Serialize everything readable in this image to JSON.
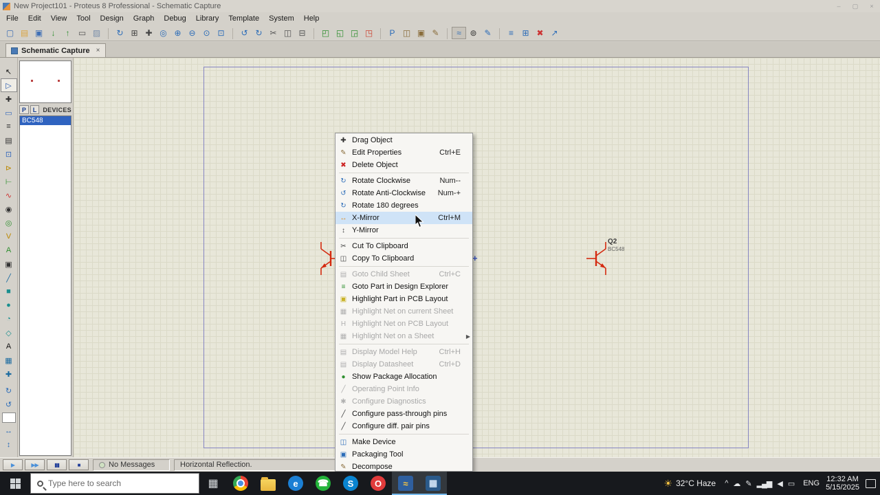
{
  "window": {
    "title": "New Project101 - Proteus 8 Professional - Schematic Capture",
    "minimize": "–",
    "maximize": "▢",
    "close": "×"
  },
  "menubar": {
    "items": [
      {
        "name": "menu-file",
        "label": "File"
      },
      {
        "name": "menu-edit",
        "label": "Edit"
      },
      {
        "name": "menu-view",
        "label": "View"
      },
      {
        "name": "menu-tool",
        "label": "Tool"
      },
      {
        "name": "menu-design",
        "label": "Design"
      },
      {
        "name": "menu-graph",
        "label": "Graph"
      },
      {
        "name": "menu-debug",
        "label": "Debug"
      },
      {
        "name": "menu-library",
        "label": "Library"
      },
      {
        "name": "menu-template",
        "label": "Template"
      },
      {
        "name": "menu-system",
        "label": "System"
      },
      {
        "name": "menu-help",
        "label": "Help"
      }
    ]
  },
  "toolbar": {
    "icons": [
      {
        "name": "new-project-icon",
        "glyph": "▢",
        "color": "#3f6fb5",
        "cls": ""
      },
      {
        "name": "open-project-icon",
        "glyph": "▤",
        "color": "#d9a441",
        "cls": ""
      },
      {
        "name": "save-project-icon",
        "glyph": "▣",
        "color": "#3f6fb5",
        "cls": ""
      },
      {
        "name": "import-section-icon",
        "glyph": "↓",
        "color": "#2f8f2f",
        "cls": ""
      },
      {
        "name": "export-section-icon",
        "glyph": "↑",
        "color": "#2f8f2f",
        "cls": ""
      },
      {
        "name": "print-icon",
        "glyph": "▭",
        "color": "#555555",
        "cls": ""
      },
      {
        "name": "mark-output-area-icon",
        "glyph": "▨",
        "color": "#7a8faa",
        "cls": ""
      },
      {
        "name": "redraw-icon",
        "glyph": "↻",
        "color": "#2b6cb8",
        "cls": "grp"
      },
      {
        "name": "toggle-grid-icon",
        "glyph": "⊞",
        "color": "#444444",
        "cls": ""
      },
      {
        "name": "false-origin-icon",
        "glyph": "✚",
        "color": "#444444",
        "cls": ""
      },
      {
        "name": "centre-at-cursor-icon",
        "glyph": "◎",
        "color": "#2b6cb8",
        "cls": ""
      },
      {
        "name": "zoom-in-icon",
        "glyph": "⊕",
        "color": "#2b6cb8",
        "cls": ""
      },
      {
        "name": "zoom-out-icon",
        "glyph": "⊖",
        "color": "#2b6cb8",
        "cls": ""
      },
      {
        "name": "zoom-all-icon",
        "glyph": "⊙",
        "color": "#2b6cb8",
        "cls": ""
      },
      {
        "name": "zoom-area-icon",
        "glyph": "⊡",
        "color": "#2b6cb8",
        "cls": ""
      },
      {
        "name": "undo-icon",
        "glyph": "↺",
        "color": "#2b6cb8",
        "cls": "grp"
      },
      {
        "name": "redo-icon",
        "glyph": "↻",
        "color": "#2b6cb8",
        "cls": ""
      },
      {
        "name": "cut-icon",
        "glyph": "✂",
        "color": "#555555",
        "cls": ""
      },
      {
        "name": "copy-icon",
        "glyph": "◫",
        "color": "#555555",
        "cls": ""
      },
      {
        "name": "paste-icon",
        "glyph": "⊟",
        "color": "#555555",
        "cls": ""
      },
      {
        "name": "copy-block-icon",
        "glyph": "◰",
        "color": "#2f8f2f",
        "cls": "grp"
      },
      {
        "name": "move-block-icon",
        "glyph": "◱",
        "color": "#2f8f2f",
        "cls": ""
      },
      {
        "name": "rotate-block-icon",
        "glyph": "◲",
        "color": "#2f8f2f",
        "cls": ""
      },
      {
        "name": "delete-block-icon",
        "glyph": "◳",
        "color": "#cc4433",
        "cls": ""
      },
      {
        "name": "pick-parts-icon",
        "glyph": "P",
        "color": "#2b6cb8",
        "cls": "grp"
      },
      {
        "name": "make-device-icon",
        "glyph": "◫",
        "color": "#8a6d3b",
        "cls": ""
      },
      {
        "name": "packaging-tool-icon",
        "glyph": "▣",
        "color": "#8a6d3b",
        "cls": ""
      },
      {
        "name": "decompose-icon",
        "glyph": "✎",
        "color": "#8a6d3b",
        "cls": ""
      },
      {
        "name": "wire-autorouter-icon",
        "glyph": "≈",
        "color": "#2b6cb8",
        "cls": "grp pressed"
      },
      {
        "name": "search-tag-icon",
        "glyph": "⊚",
        "color": "#333333",
        "cls": ""
      },
      {
        "name": "property-assignment-icon",
        "glyph": "✎",
        "color": "#2b6cb8",
        "cls": ""
      },
      {
        "name": "design-explorer-icon",
        "glyph": "≡",
        "color": "#2b6cb8",
        "cls": "grp"
      },
      {
        "name": "new-sheet-icon",
        "glyph": "⊞",
        "color": "#2b6cb8",
        "cls": ""
      },
      {
        "name": "remove-sheet-icon",
        "glyph": "✖",
        "color": "#cc3333",
        "cls": ""
      },
      {
        "name": "goto-sheet-icon",
        "glyph": "↗",
        "color": "#2b6cb8",
        "cls": ""
      }
    ]
  },
  "tabbar": {
    "active_tab": "Schematic Capture",
    "close_glyph": "×"
  },
  "sidebar": {
    "tools": [
      {
        "name": "selection-mode-icon",
        "glyph": "↖",
        "color": "#111111",
        "cls": ""
      },
      {
        "name": "component-mode-icon",
        "glyph": "▷",
        "color": "#2255aa",
        "cls": "active"
      },
      {
        "name": "junction-dot-mode-icon",
        "glyph": "✚",
        "color": "#333333",
        "cls": ""
      },
      {
        "name": "wire-label-mode-icon",
        "glyph": "▭",
        "color": "#3366bb",
        "cls": ""
      },
      {
        "name": "text-script-mode-icon",
        "glyph": "≡",
        "color": "#333333",
        "cls": ""
      },
      {
        "name": "buses-mode-icon",
        "glyph": "▤",
        "color": "#333333",
        "cls": ""
      },
      {
        "name": "subcircuit-mode-icon",
        "glyph": "⊡",
        "color": "#3366bb",
        "cls": ""
      },
      {
        "name": "terminal-mode-icon",
        "glyph": "⊳",
        "color": "#bb8800",
        "cls": ""
      },
      {
        "name": "device-pin-mode-icon",
        "glyph": "⊢",
        "color": "#2f8f2f",
        "cls": ""
      },
      {
        "name": "graph-mode-icon",
        "glyph": "∿",
        "color": "#cc3333",
        "cls": ""
      },
      {
        "name": "tape-recorder-mode-icon",
        "glyph": "◉",
        "color": "#333333",
        "cls": ""
      },
      {
        "name": "generator-mode-icon",
        "glyph": "◎",
        "color": "#2f8f2f",
        "cls": ""
      },
      {
        "name": "voltage-probe-mode-icon",
        "glyph": "V",
        "color": "#bb8800",
        "cls": ""
      },
      {
        "name": "current-probe-mode-icon",
        "glyph": "A",
        "color": "#2f8f2f",
        "cls": ""
      },
      {
        "name": "virtual-instruments-mode-icon",
        "glyph": "▣",
        "color": "#333333",
        "cls": ""
      },
      {
        "name": "graphics-line-mode-icon",
        "glyph": "╱",
        "color": "#1a6aa0",
        "cls": ""
      },
      {
        "name": "graphics-box-mode-icon",
        "glyph": "■",
        "color": "#1a8f8f",
        "cls": ""
      },
      {
        "name": "graphics-circle-mode-icon",
        "glyph": "●",
        "color": "#1a8f8f",
        "cls": ""
      },
      {
        "name": "graphics-arc-mode-icon",
        "glyph": "◔",
        "color": "#1a8f8f",
        "cls": ""
      },
      {
        "name": "graphics-path-mode-icon",
        "glyph": "◇",
        "color": "#1a8f8f",
        "cls": ""
      },
      {
        "name": "graphics-text-mode-icon",
        "glyph": "A",
        "color": "#111111",
        "cls": ""
      },
      {
        "name": "graphics-symbol-mode-icon",
        "glyph": "▦",
        "color": "#1a6aa0",
        "cls": ""
      },
      {
        "name": "markers-mode-icon",
        "glyph": "✚",
        "color": "#1a6aa0",
        "cls": ""
      }
    ],
    "rotate": [
      {
        "name": "rotate-clockwise-button",
        "glyph": "↻"
      },
      {
        "name": "rotate-anticlockwise-button",
        "glyph": "↺"
      }
    ],
    "mirror": [
      {
        "name": "x-mirror-button",
        "glyph": "↔"
      },
      {
        "name": "y-mirror-button",
        "glyph": "↕"
      }
    ],
    "angle_value": ""
  },
  "devices": {
    "p_label": "P",
    "l_label": "L",
    "title": "DEVICES",
    "items": [
      {
        "name": "device-bc548",
        "label": "BC548",
        "cls": "selected"
      }
    ]
  },
  "canvas": {
    "q2_ref": "Q2",
    "q2_value": "BC548"
  },
  "context_menu": {
    "items": [
      {
        "name": "menu-item-drag-object",
        "icon": "drag-object-icon",
        "glyph": "✚",
        "color": "#333333",
        "label": "Drag Object",
        "cls": ""
      },
      {
        "name": "menu-item-edit-properties",
        "icon": "edit-properties-icon",
        "glyph": "✎",
        "color": "#8a6d3b",
        "label": "Edit Properties",
        "shortcut": "Ctrl+E",
        "cls": ""
      },
      {
        "name": "menu-item-delete-object",
        "icon": "delete-object-icon",
        "glyph": "✖",
        "color": "#cc2222",
        "label": "Delete Object",
        "cls": ""
      },
      {
        "name": "menu-separator",
        "cls": "separator",
        "inter": "false"
      },
      {
        "name": "menu-item-rotate-clockwise",
        "icon": "rotate-clockwise-icon",
        "glyph": "↻",
        "color": "#2b6cb8",
        "label": "Rotate Clockwise",
        "shortcut": "Num--",
        "cls": ""
      },
      {
        "name": "menu-item-rotate-anticlockwise",
        "icon": "rotate-anticlockwise-icon",
        "glyph": "↺",
        "color": "#2b6cb8",
        "label": "Rotate Anti-Clockwise",
        "shortcut": "Num-+",
        "cls": ""
      },
      {
        "name": "menu-item-rotate-180",
        "icon": "rotate-180-icon",
        "glyph": "↻",
        "color": "#2b6cb8",
        "label": "Rotate 180 degrees",
        "cls": ""
      },
      {
        "name": "menu-item-x-mirror",
        "icon": "x-mirror-icon",
        "glyph": "↔",
        "color": "#d98f2b",
        "label": "X-Mirror",
        "shortcut": "Ctrl+M",
        "cls": "highlighted"
      },
      {
        "name": "menu-item-y-mirror",
        "icon": "y-mirror-icon",
        "glyph": "↕",
        "color": "#444444",
        "label": "Y-Mirror",
        "cls": ""
      },
      {
        "name": "menu-separator",
        "cls": "separator",
        "inter": "false"
      },
      {
        "name": "menu-item-cut-to-clipboard",
        "icon": "cut-icon",
        "glyph": "✂",
        "color": "#444444",
        "label": "Cut To Clipboard",
        "cls": ""
      },
      {
        "name": "menu-item-copy-to-clipboard",
        "icon": "copy-icon",
        "glyph": "◫",
        "color": "#444444",
        "label": "Copy To Clipboard",
        "cls": ""
      },
      {
        "name": "menu-separator",
        "cls": "separator",
        "inter": "false"
      },
      {
        "name": "menu-item-goto-child-sheet",
        "icon": "goto-child-sheet-icon",
        "glyph": "▤",
        "color": "#b0b0b0",
        "label": "Goto Child Sheet",
        "shortcut": "Ctrl+C",
        "cls": "disabled"
      },
      {
        "name": "menu-item-goto-part-in-design-explorer",
        "icon": "design-explorer-icon",
        "glyph": "≡",
        "color": "#2f8f2f",
        "label": "Goto Part in Design Explorer",
        "cls": ""
      },
      {
        "name": "menu-item-highlight-part-in-pcb-layout",
        "icon": "highlight-part-icon",
        "glyph": "▣",
        "color": "#c9b227",
        "label": "Highlight Part in PCB Layout",
        "cls": ""
      },
      {
        "name": "menu-item-highlight-net-current-sheet",
        "icon": "highlight-net-sheet-icon",
        "glyph": "▦",
        "color": "#b0b0b0",
        "label": "Highlight Net on current Sheet",
        "cls": "disabled"
      },
      {
        "name": "menu-item-highlight-net-pcb-layout",
        "icon": "highlight-net-pcb-icon",
        "glyph": "H",
        "color": "#b0b0b0",
        "label": "Highlight Net on PCB Layout",
        "cls": "disabled"
      },
      {
        "name": "menu-item-highlight-net-a-sheet",
        "icon": "highlight-net-a-sheet-icon",
        "glyph": "▦",
        "color": "#b0b0b0",
        "label": "Highlight Net on a Sheet",
        "cls": "disabled",
        "arrow": "▶"
      },
      {
        "name": "menu-separator",
        "cls": "separator",
        "inter": "false"
      },
      {
        "name": "menu-item-display-model-help",
        "icon": "model-help-icon",
        "glyph": "▤",
        "color": "#b0b0b0",
        "label": "Display Model Help",
        "shortcut": "Ctrl+H",
        "cls": "disabled"
      },
      {
        "name": "menu-item-display-datasheet",
        "icon": "datasheet-icon",
        "glyph": "▤",
        "color": "#b0b0b0",
        "label": "Display Datasheet",
        "shortcut": "Ctrl+D",
        "cls": "disabled"
      },
      {
        "name": "menu-item-show-package-allocation",
        "icon": "package-allocation-icon",
        "glyph": "●",
        "color": "#2f8f2f",
        "label": "Show Package Allocation",
        "cls": ""
      },
      {
        "name": "menu-item-operating-point-info",
        "icon": "operating-point-icon",
        "glyph": "╱",
        "color": "#b0b0b0",
        "label": "Operating Point Info",
        "cls": "disabled"
      },
      {
        "name": "menu-item-configure-diagnostics",
        "icon": "diagnostics-icon",
        "glyph": "✱",
        "color": "#b0b0b0",
        "label": "Configure Diagnostics",
        "cls": "disabled"
      },
      {
        "name": "menu-item-configure-pass-through-pins",
        "icon": "pass-through-pins-icon",
        "glyph": "╱",
        "color": "#444444",
        "label": "Configure pass-through pins",
        "cls": ""
      },
      {
        "name": "menu-item-configure-diff-pair-pins",
        "icon": "diff-pair-pins-icon",
        "glyph": "╱",
        "color": "#444444",
        "label": "Configure diff. pair pins",
        "cls": ""
      },
      {
        "name": "menu-separator",
        "cls": "separator",
        "inter": "false"
      },
      {
        "name": "menu-item-make-device",
        "icon": "make-device-icon",
        "glyph": "◫",
        "color": "#2b6cb8",
        "label": "Make Device",
        "cls": ""
      },
      {
        "name": "menu-item-packaging-tool",
        "icon": "packaging-tool-icon",
        "glyph": "▣",
        "color": "#2b6cb8",
        "label": "Packaging Tool",
        "cls": ""
      },
      {
        "name": "menu-item-decompose",
        "icon": "decompose-icon",
        "glyph": "✎",
        "color": "#8a6d3b",
        "label": "Decompose",
        "cls": ""
      }
    ]
  },
  "statusbar": {
    "sim": [
      {
        "name": "play-button",
        "glyph": "▶",
        "color": "#4a90d9"
      },
      {
        "name": "step-button",
        "glyph": "▶▶",
        "color": "#4a90d9"
      },
      {
        "name": "pause-button",
        "glyph": "▮▮",
        "color": "#23409a"
      },
      {
        "name": "stop-button",
        "glyph": "■",
        "color": "#23409a"
      }
    ],
    "no_messages": "No Messages",
    "message": "Horizontal Reflection."
  },
  "taskbar": {
    "search_placeholder": "Type here to search",
    "apps": [
      {
        "name": "task-view-button",
        "icon_cls": "flat",
        "glyph": "▦",
        "fg": "#d8dcdf",
        "cls": ""
      },
      {
        "name": "chrome-icon",
        "icon_cls": "chrome",
        "cls": ""
      },
      {
        "name": "file-explorer-icon",
        "icon_cls": "folder",
        "cls": ""
      },
      {
        "name": "edge-icon",
        "icon_cls": "round",
        "glyph": "e",
        "bg": "#1b7fd4",
        "fg": "#ffffff",
        "cls": ""
      },
      {
        "name": "whatsapp-icon",
        "icon_cls": "round",
        "glyph": "☎",
        "bg": "#23b33a",
        "fg": "#ffffff",
        "cls": ""
      },
      {
        "name": "skype-icon",
        "icon_cls": "round",
        "glyph": "S",
        "bg": "#0a84d0",
        "fg": "#ffffff",
        "cls": ""
      },
      {
        "name": "opera-icon",
        "icon_cls": "round",
        "glyph": "O",
        "bg": "#e13b3b",
        "fg": "#ffffff",
        "cls": ""
      },
      {
        "name": "proteus-icon",
        "icon_cls": "square",
        "glyph": "≈",
        "bg": "#2f5f9e",
        "fg": "#ffc83d",
        "cls": "active"
      },
      {
        "name": "proteus-capture-icon",
        "icon_cls": "square",
        "glyph": "▦",
        "bg": "#2a5a8a",
        "fg": "#cfe2f5",
        "cls": "active"
      }
    ],
    "weather_icon": "☀",
    "weather": "32°C Haze",
    "tray": [
      {
        "name": "hidden-icons-button",
        "glyph": "^"
      },
      {
        "name": "onedrive-icon",
        "glyph": "☁"
      },
      {
        "name": "pen-icon",
        "glyph": "✎"
      },
      {
        "name": "network-icon",
        "glyph": "▂▄▆"
      },
      {
        "name": "volume-icon",
        "glyph": "◀"
      },
      {
        "name": "battery-icon",
        "glyph": "▭"
      }
    ],
    "language": "ENG",
    "time": "12:32 AM",
    "date": "5/15/2025"
  }
}
